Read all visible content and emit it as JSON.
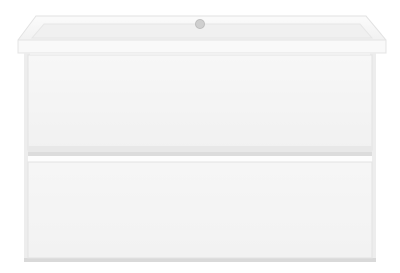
{
  "image": {
    "subject": "wall-hung-vanity-unit-icon",
    "colors": {
      "background": "#ffffff",
      "body": "#f4f4f4",
      "edge": "#e2e2e2",
      "shadow": "#d6d6d6",
      "tap_hole": "#cfcfcf"
    },
    "drawer_count": 2
  }
}
